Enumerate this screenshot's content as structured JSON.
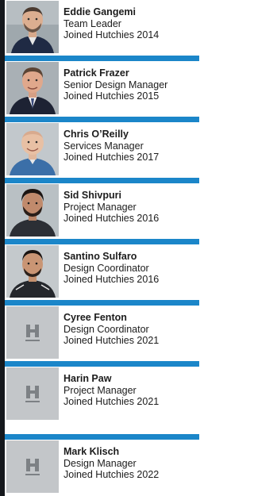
{
  "colors": {
    "accent": "#1b86c9",
    "rail": "#15181d",
    "placeholder": "#c3c6c9",
    "placeholder_logo": "#7d8185",
    "text": "#1c1c1c"
  },
  "team": [
    {
      "name": "Eddie Gangemi",
      "role": "Team Leader",
      "joined": "Joined Hutchies 2014",
      "photo": "portrait"
    },
    {
      "name": "Patrick Frazer",
      "role": "Senior Design Manager",
      "joined": "Joined Hutchies 2015",
      "photo": "portrait"
    },
    {
      "name": "Chris O’Reilly",
      "role": "Services Manager",
      "joined": "Joined Hutchies 2017",
      "photo": "portrait"
    },
    {
      "name": "Sid Shivpuri",
      "role": "Project Manager",
      "joined": "Joined Hutchies 2016",
      "photo": "portrait"
    },
    {
      "name": "Santino Sulfaro",
      "role": "Design Coordinator",
      "joined": "Joined Hutchies 2016",
      "photo": "portrait"
    },
    {
      "name": "Cyree Fenton",
      "role": "Design Coordinator",
      "joined": "Joined Hutchies 2021",
      "photo": "hutchies-logo-placeholder"
    },
    {
      "name": "Harin Paw",
      "role": "Project Manager",
      "joined": "Joined Hutchies 2021",
      "photo": "hutchies-logo-placeholder"
    },
    {
      "name": "Mark Klisch",
      "role": "Design Manager",
      "joined": "Joined Hutchies 2022",
      "photo": "hutchies-logo-placeholder"
    }
  ]
}
